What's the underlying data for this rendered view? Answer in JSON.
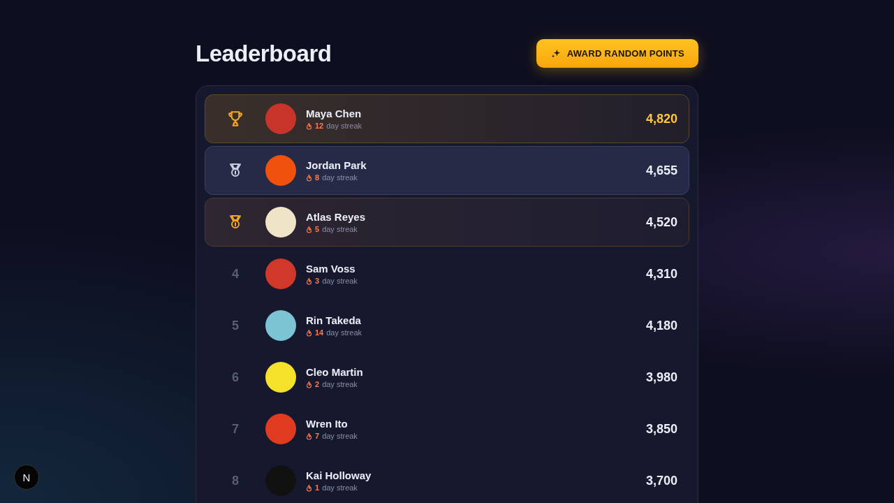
{
  "header": {
    "title": "Leaderboard",
    "award_button": {
      "label": "AWARD RANDOM POINTS"
    }
  },
  "players": [
    {
      "kind": "gold",
      "name": "Maya Chen",
      "streak": "12",
      "streak_label": "day streak",
      "score": "4,820",
      "color": "#c8342a"
    },
    {
      "kind": "silver",
      "name": "Jordan Park",
      "streak": "8",
      "streak_label": "day streak",
      "score": "4,655",
      "color": "#f0520e"
    },
    {
      "kind": "bronze",
      "name": "Atlas Reyes",
      "streak": "5",
      "streak_label": "day streak",
      "score": "4,520",
      "color": "#efe3c8"
    },
    {
      "kind": "plain",
      "rank": "4",
      "name": "Sam Voss",
      "streak": "3",
      "streak_label": "day streak",
      "score": "4,310",
      "color": "#d0382a"
    },
    {
      "kind": "plain",
      "rank": "5",
      "name": "Rin Takeda",
      "streak": "14",
      "streak_label": "day streak",
      "score": "4,180",
      "color": "#7cc4d4"
    },
    {
      "kind": "plain",
      "rank": "6",
      "name": "Cleo Martin",
      "streak": "2",
      "streak_label": "day streak",
      "score": "3,980",
      "color": "#f5e02a"
    },
    {
      "kind": "plain",
      "rank": "7",
      "name": "Wren Ito",
      "streak": "7",
      "streak_label": "day streak",
      "score": "3,850",
      "color": "#e03a20"
    },
    {
      "kind": "plain",
      "rank": "8",
      "name": "Kai Holloway",
      "streak": "1",
      "streak_label": "day streak",
      "score": "3,700",
      "color": "#111111"
    }
  ],
  "dev_badge": {
    "label": "N"
  }
}
